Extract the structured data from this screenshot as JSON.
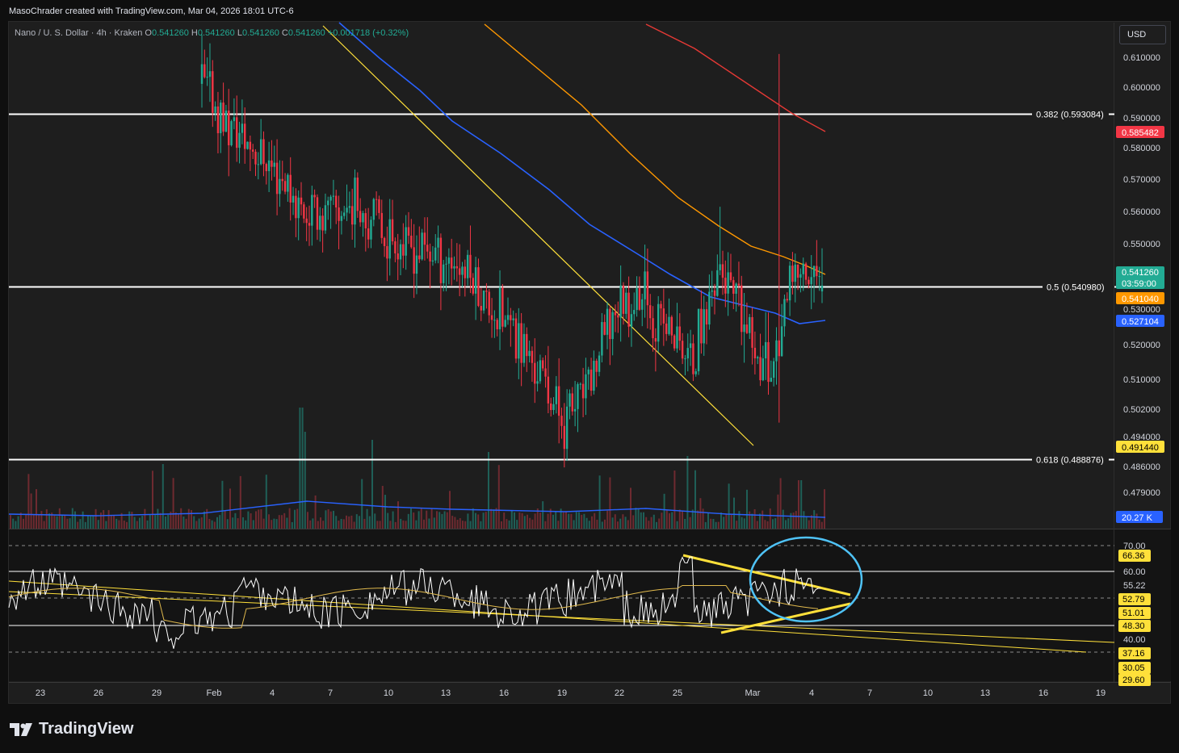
{
  "attribution": "MasoChrader created with TradingView.com, Mar 04, 2026 18:01 UTC-6",
  "symbol": {
    "name": "Nano / U. S. Dollar · 4h · Kraken",
    "open_label": "O",
    "open": "0.541260",
    "high_label": "H",
    "high": "0.541260",
    "low_label": "L",
    "low": "0.541260",
    "close_label": "C",
    "close": "0.541260",
    "change": "+0.001718 (+0.32%)"
  },
  "currency_button": "USD",
  "brand": "TradingView",
  "colors": {
    "up": "#22ab94",
    "down": "#f23645",
    "ma_blue": "#2962ff",
    "ma_orange": "#ff9800",
    "ma_red": "#e53935",
    "trend_yellow": "#ffe03a",
    "rsi_line": "#ffffff",
    "rsi_ma": "#e0b94d",
    "circle": "#4fc3f7"
  },
  "chart_data": {
    "type": "candlestick",
    "price_axis": {
      "range": [
        0.474,
        0.618
      ],
      "ticks": [
        "0.610000",
        "0.600000",
        "0.590000",
        "0.580000",
        "0.570000",
        "0.560000",
        "0.550000",
        "0.530000",
        "0.520000",
        "0.510000",
        "0.502000",
        "0.494000",
        "0.486000",
        "0.479000"
      ]
    },
    "x_axis_ticks": [
      "23",
      "26",
      "29",
      "Feb",
      "4",
      "7",
      "10",
      "13",
      "16",
      "19",
      "22",
      "25",
      "Mar",
      "4",
      "7",
      "10",
      "13",
      "16",
      "19"
    ],
    "fib_levels": [
      {
        "label": "0.382 (0.593084)",
        "value": 0.593084
      },
      {
        "label": "0.5 (0.540980)",
        "value": 0.54098
      },
      {
        "label": "0.618 (0.488876)",
        "value": 0.488876
      }
    ],
    "price_badges": [
      {
        "text": "0.585482",
        "role": "ma-200",
        "color": "#f23645",
        "value": 0.585482
      },
      {
        "text": "0.541260",
        "sub": "03:59:00",
        "role": "last-price",
        "color": "#22ab94",
        "value": 0.54126
      },
      {
        "text": "0.541040",
        "role": "ma-100",
        "color": "#ff9800",
        "value": 0.54104
      },
      {
        "text": "0.527104",
        "role": "ma-50",
        "color": "#2962ff",
        "value": 0.527104
      },
      {
        "text": "0.491440",
        "role": "trendline",
        "color": "#ffe03a",
        "value": 0.49144
      }
    ],
    "volume": {
      "badge": "20.27 K"
    },
    "rsi": {
      "ticks": [
        "70.00",
        "60.00",
        "55.22",
        "40.00"
      ],
      "badges": [
        {
          "text": "66.36",
          "color": "#ffe03a",
          "value": 66.36
        },
        {
          "text": "52.79",
          "color": "#ffe03a",
          "value": 52.79
        },
        {
          "text": "51.01",
          "color": "#ffe03a",
          "value": 51.01
        },
        {
          "text": "48.30",
          "color": "#ffe03a",
          "value": 48.3
        },
        {
          "text": "37.16",
          "color": "#ffe03a",
          "value": 37.16
        },
        {
          "text": "30.05",
          "color": "#ffe03a",
          "value": 30.05
        },
        {
          "text": "29.60",
          "color": "#ffe03a",
          "value": 29.6
        }
      ]
    },
    "ohlc_anchor": [
      [
        0.62,
        0.602,
        0.625,
        0.6
      ],
      [
        0.603,
        0.59,
        0.608,
        0.575
      ],
      [
        0.59,
        0.583,
        0.595,
        0.57
      ],
      [
        0.583,
        0.575,
        0.592,
        0.565
      ],
      [
        0.576,
        0.563,
        0.586,
        0.552
      ],
      [
        0.562,
        0.563,
        0.576,
        0.552
      ],
      [
        0.563,
        0.566,
        0.577,
        0.556
      ],
      [
        0.566,
        0.558,
        0.572,
        0.549
      ],
      [
        0.558,
        0.553,
        0.563,
        0.547
      ],
      [
        0.553,
        0.552,
        0.556,
        0.546
      ],
      [
        0.552,
        0.548,
        0.555,
        0.54
      ],
      [
        0.548,
        0.537,
        0.553,
        0.53
      ],
      [
        0.537,
        0.528,
        0.54,
        0.52
      ],
      [
        0.528,
        0.516,
        0.53,
        0.505
      ],
      [
        0.516,
        0.5,
        0.522,
        0.497
      ],
      [
        0.5,
        0.512,
        0.515,
        0.498
      ],
      [
        0.512,
        0.535,
        0.538,
        0.51
      ],
      [
        0.535,
        0.538,
        0.565,
        0.53
      ],
      [
        0.538,
        0.528,
        0.542,
        0.518
      ],
      [
        0.528,
        0.518,
        0.535,
        0.503
      ],
      [
        0.518,
        0.548,
        0.551,
        0.51
      ],
      [
        0.548,
        0.528,
        0.553,
        0.512
      ],
      [
        0.528,
        0.516,
        0.546,
        0.508
      ],
      [
        0.516,
        0.545,
        0.611,
        0.5
      ],
      [
        0.545,
        0.541,
        0.553,
        0.536
      ]
    ]
  }
}
